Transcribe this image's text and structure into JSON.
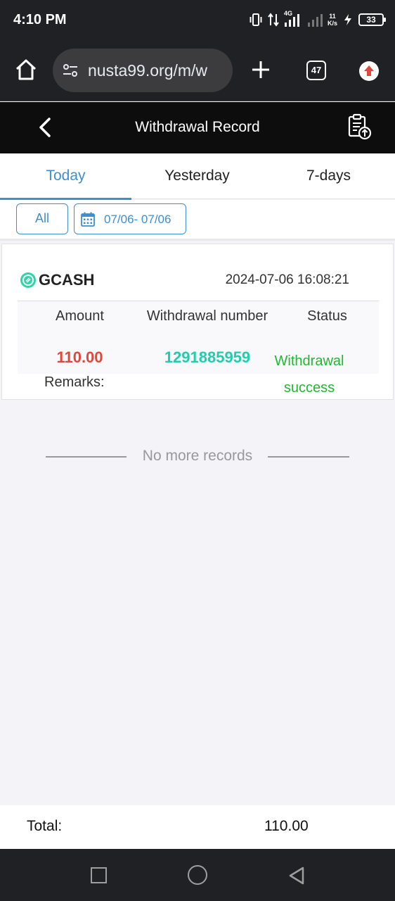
{
  "status_bar": {
    "time": "4:10 PM",
    "network": "4G",
    "speed_value": "11",
    "speed_unit": "K/s",
    "battery": "33"
  },
  "browser": {
    "url": "nusta99.org/m/w",
    "tab_count": "47"
  },
  "header": {
    "title": "Withdrawal Record"
  },
  "tabs": [
    {
      "label": "Today",
      "active": true
    },
    {
      "label": "Yesterday",
      "active": false
    },
    {
      "label": "7-days",
      "active": false
    }
  ],
  "filters": {
    "type_label": "All",
    "date_range": "07/06- 07/06"
  },
  "record": {
    "channel": "GCASH",
    "datetime": "2024-07-06 16:08:21",
    "headers": {
      "amount": "Amount",
      "number": "Withdrawal number",
      "status": "Status"
    },
    "amount": "110.00",
    "number": "1291885959",
    "status_line1": "Withdrawal",
    "status_line2": "success",
    "remarks_label": "Remarks:"
  },
  "no_more_text": "No more records",
  "total": {
    "label": "Total:",
    "value": "110.00"
  },
  "colors": {
    "accent": "#3d8fd1",
    "amount": "#e2473b",
    "number": "#1fcfac",
    "success": "#22b830"
  }
}
